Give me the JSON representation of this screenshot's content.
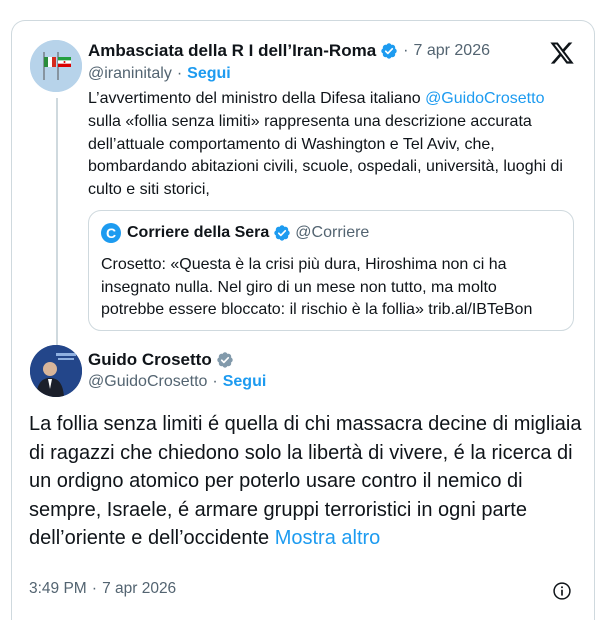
{
  "tweet_original": {
    "author_name": "Ambasciata della R I dell’Iran-Roma",
    "author_handle": "@iraninitaly",
    "date": "7 apr 2026",
    "follow_label": "Segui",
    "text_part1": "L’avvertimento del ministro della Difesa italiano ",
    "mention": "@GuidoCrosetto",
    "text_part2": " sulla «follia senza limiti» rappresenta una descrizione accurata dell’attuale comportamento di Washington e Tel Aviv, che, bombardando abitazioni civili, scuole, ospedali, università, luoghi di culto e siti storici,"
  },
  "quote": {
    "logo_letter": "C",
    "author_name": "Corriere della Sera",
    "author_handle": "@Corriere",
    "text": "Crosetto: «Questa è la crisi più dura, Hiroshima non ci ha insegnato nulla. Nel giro di un mese non tutto, ma molto potrebbe essere bloccato: il rischio è la follia» trib.al/IBTeBon"
  },
  "reply": {
    "author_name": "Guido Crosetto",
    "author_handle": "@GuidoCrosetto",
    "follow_label": "Segui",
    "text": "La follia senza limiti é quella di chi massacra decine di migliaia di ragazzi che chiedono solo la libertà di vivere, é la ricerca di un ordigno atomico per poterlo usare contro il nemico di sempre, Israele, é armare gruppi terroristici in ogni parte dell’oriente e dell’occidente ",
    "show_more_label": "Mostra altro",
    "time": "3:49 PM",
    "date": "7 apr 2026"
  },
  "separator": "·",
  "icons": {
    "verified_blue": "verified-badge-icon",
    "verified_gray": "verified-gray-badge-icon",
    "x_logo": "x-logo-icon",
    "info": "info-icon"
  },
  "colors": {
    "accent": "#1d9bf0",
    "secondary_text": "#536471",
    "border": "#cfd9de",
    "verified_gray": "#829aab"
  }
}
